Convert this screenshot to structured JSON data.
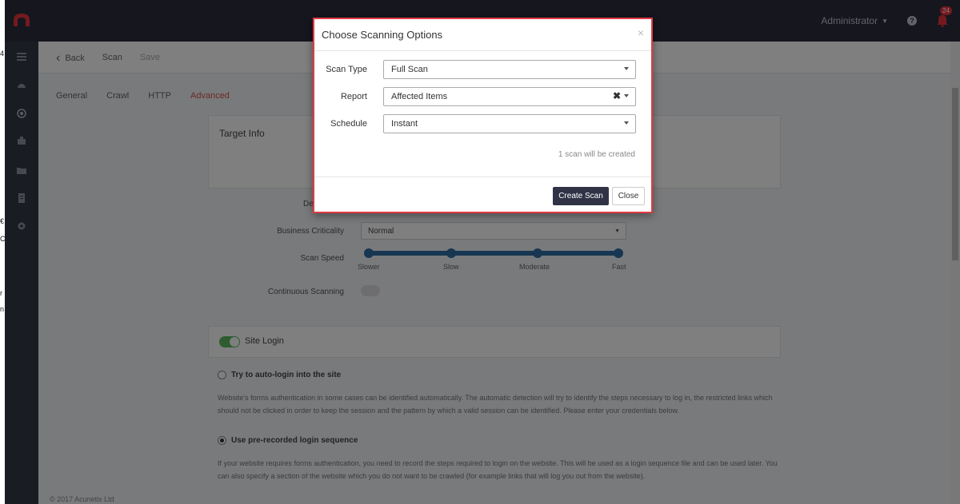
{
  "edge_glyphs": [
    "4",
    "€",
    "C",
    "r",
    "n"
  ],
  "topbar": {
    "user_label": "Administrator",
    "notification_count": "24"
  },
  "sidebar": {
    "icons": [
      "list-icon",
      "dashboard-icon",
      "target-icon",
      "scans-icon",
      "folder-icon",
      "report-icon",
      "settings-icon"
    ]
  },
  "breadcrumb": {
    "back": "Back",
    "scan": "Scan",
    "current": "Save"
  },
  "tabs": [
    "General",
    "Crawl",
    "HTTP",
    "Advanced"
  ],
  "target_info": {
    "title": "Target Info",
    "partial_label": "De"
  },
  "settings": {
    "criticality_label": "Business Criticality",
    "criticality_value": "Normal",
    "speed_label": "Scan Speed",
    "speed_stops": [
      "Slower",
      "Slow",
      "Moderate",
      "Fast"
    ],
    "continuous_label": "Continuous Scanning"
  },
  "site_login": {
    "title": "Site Login",
    "enabled": true,
    "option_auto": "Try to auto-login into the site",
    "option_auto_desc": "Website's forms authentication in some cases can be identified automatically. The automatic detection will try to identify the steps necessary to log in, the restricted links which should not be clicked in order to keep the session and the pattern by which a valid session can be identified. Please enter your credentials below.",
    "option_recorded": "Use pre-recorded login sequence",
    "option_recorded_desc": "If your website requires forms authentication, you need to record the steps required to login on the website. This will be used as a login sequence file and can be used later. You can also specify a section of the website which you do not want to be crawled (for example links that will log you out from the website)."
  },
  "footer_text": "© 2017 Acunetix Ltd",
  "modal": {
    "title": "Choose Scanning Options",
    "close_glyph": "×",
    "scan_type_label": "Scan Type",
    "scan_type_value": "Full Scan",
    "report_label": "Report",
    "report_value": "Affected Items",
    "report_clear_glyph": "✖",
    "schedule_label": "Schedule",
    "schedule_value": "Instant",
    "note": "1 scan will be created",
    "create_button": "Create Scan",
    "close_button": "Close"
  },
  "colors": {
    "topbar": "#2a2d3c",
    "sidebar": "#353849",
    "modal_border": "#e03a43",
    "primary_button": "#2f3345",
    "toggle_on": "#5cb85c",
    "slider": "#2e6da4"
  }
}
